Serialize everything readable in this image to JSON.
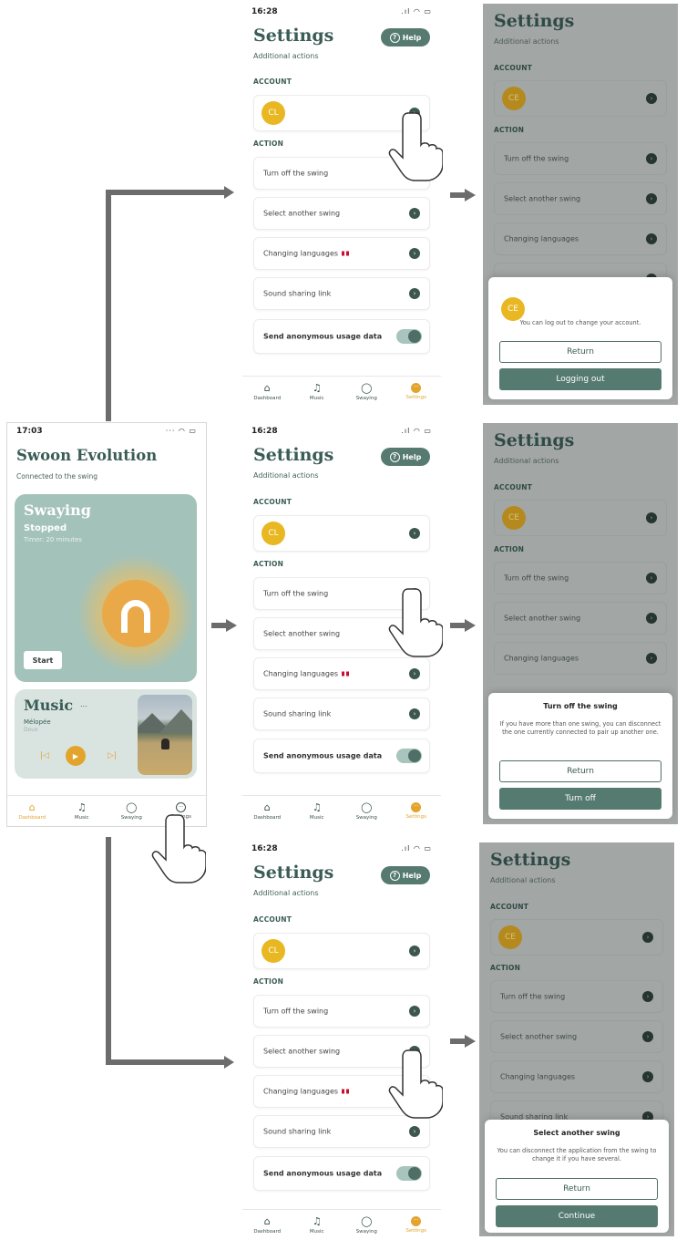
{
  "settings": {
    "title": "Settings",
    "subtitle": "Additional actions",
    "help": "Help",
    "account_header": "ACCOUNT",
    "action_header": "ACTION",
    "actions": [
      "Turn off the swing",
      "Select another swing",
      "Changing languages",
      "Sound sharing link"
    ],
    "usage_label": "Send anonymous usage data"
  },
  "avatars": {
    "light": "CL",
    "overlay": "CE"
  },
  "status": {
    "time_settings": "16:28",
    "time_dashboard": "17:03"
  },
  "tabs": [
    "Dashboard",
    "Music",
    "Swaying",
    "Settings"
  ],
  "dashboard": {
    "title": "Swoon Evolution",
    "subtitle": "Connected to the swing",
    "swaying": {
      "title": "Swaying",
      "state": "Stopped",
      "timer": "Timer: 20 minutes",
      "start": "Start"
    },
    "music": {
      "title": "Music",
      "more": "...",
      "track": "Mélopée",
      "mood": "Doux"
    }
  },
  "modals": {
    "logout": {
      "body": "You can log out to change your account.",
      "return": "Return",
      "confirm": "Logging out"
    },
    "turn_off": {
      "title": "Turn off the swing",
      "body": "If you have more than one swing, you can disconnect the one currently connected to pair up another one.",
      "return": "Return",
      "confirm": "Turn off"
    },
    "select": {
      "title": "Select another swing",
      "body": "You can disconnect the application from the swing to change it if you have several.",
      "return": "Return",
      "confirm": "Continue"
    }
  },
  "colors": {
    "primary": "#557a70",
    "accent": "#e3a42e",
    "avatar": "#e8b722",
    "overlay": "#a2a6a5"
  }
}
